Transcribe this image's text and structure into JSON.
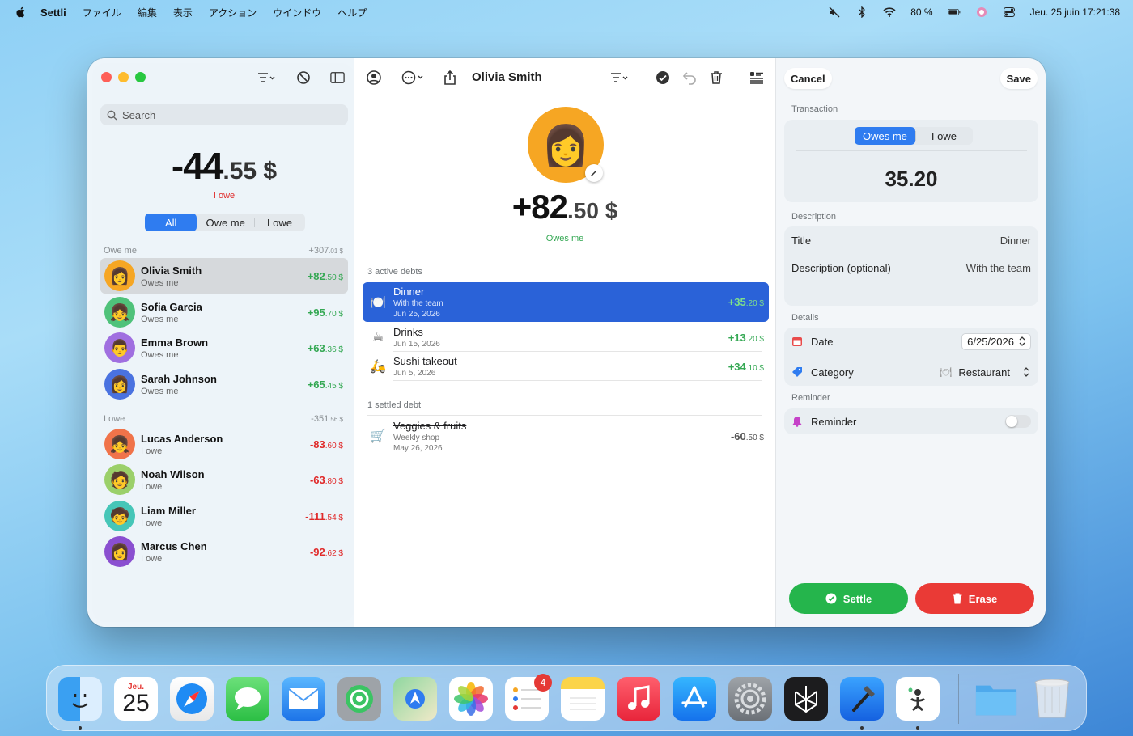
{
  "menubar": {
    "app_name": "Settli",
    "items": [
      "ファイル",
      "編集",
      "表示",
      "アクション",
      "ウインドウ",
      "ヘルプ"
    ],
    "battery": "80 %",
    "datetime": "Jeu. 25 juin  17:21:38"
  },
  "sidebar": {
    "search_placeholder": "Search",
    "total_main": "-44",
    "total_cents": ".55 $",
    "total_status": "I owe",
    "filters": [
      "All",
      "Owe me",
      "I owe"
    ],
    "owe_me_section": {
      "label": "Owe me",
      "amount_main": "+307",
      "amount_cents": ".01 $"
    },
    "i_owe_section": {
      "label": "I owe",
      "amount_main": "-351",
      "amount_cents": ".56 $"
    },
    "owe_me_people": [
      {
        "name": "Olivia Smith",
        "status": "Owes me",
        "amount_main": "+82",
        "amount_cents": ".50 $",
        "color": "#f6a623",
        "emoji": "👩"
      },
      {
        "name": "Sofia Garcia",
        "status": "Owes me",
        "amount_main": "+95",
        "amount_cents": ".70 $",
        "color": "#4fc27a",
        "emoji": "👧"
      },
      {
        "name": "Emma Brown",
        "status": "Owes me",
        "amount_main": "+63",
        "amount_cents": ".36 $",
        "color": "#a06fe0",
        "emoji": "👨"
      },
      {
        "name": "Sarah Johnson",
        "status": "Owes me",
        "amount_main": "+65",
        "amount_cents": ".45 $",
        "color": "#4a72e0",
        "emoji": "👩"
      }
    ],
    "i_owe_people": [
      {
        "name": "Lucas Anderson",
        "status": "I owe",
        "amount_main": "-83",
        "amount_cents": ".60 $",
        "color": "#f0734a",
        "emoji": "👧"
      },
      {
        "name": "Noah Wilson",
        "status": "I owe",
        "amount_main": "-63",
        "amount_cents": ".80 $",
        "color": "#9bd06a",
        "emoji": "🧑"
      },
      {
        "name": "Liam Miller",
        "status": "I owe",
        "amount_main": "-111",
        "amount_cents": ".54 $",
        "color": "#46c6b8",
        "emoji": "🧒"
      },
      {
        "name": "Marcus Chen",
        "status": "I owe",
        "amount_main": "-92",
        "amount_cents": ".62 $",
        "color": "#8a4fd0",
        "emoji": "👩"
      }
    ]
  },
  "detail": {
    "person_name": "Olivia Smith",
    "total_main": "+82",
    "total_cents": ".50 $",
    "status": "Owes me",
    "active_header": "3 active debts",
    "active_debts": [
      {
        "title": "Dinner",
        "subtitle": "With the team",
        "date": "Jun 25, 2026",
        "amount_main": "+35",
        "amount_cents": ".20 $",
        "icon": "🍽️"
      },
      {
        "title": "Drinks",
        "subtitle": "",
        "date": "Jun 15, 2026",
        "amount_main": "+13",
        "amount_cents": ".20 $",
        "icon": "☕"
      },
      {
        "title": "Sushi takeout",
        "subtitle": "",
        "date": "Jun 5, 2026",
        "amount_main": "+34",
        "amount_cents": ".10 $",
        "icon": "🛵"
      }
    ],
    "settled_header": "1 settled debt",
    "settled_debts": [
      {
        "title": "Veggies & fruits",
        "subtitle": "Weekly shop",
        "date": "May 26, 2026",
        "amount_main": "-60",
        "amount_cents": ".50 $",
        "icon": "🛒"
      }
    ]
  },
  "editor": {
    "cancel": "Cancel",
    "save": "Save",
    "transaction_label": "Transaction",
    "type_options": [
      "Owes me",
      "I owe"
    ],
    "amount": "35.20",
    "description_label": "Description",
    "title_label": "Title",
    "title_value": "Dinner",
    "desc_label": "Description (optional)",
    "desc_value": "With the team",
    "details_label": "Details",
    "date_label": "Date",
    "date_value": "6/25/2026",
    "category_label": "Category",
    "category_value": "Restaurant",
    "reminder_section": "Reminder",
    "reminder_label": "Reminder",
    "reminder_on": false,
    "settle": "Settle",
    "erase": "Erase"
  },
  "dock": {
    "calendar_month": "Jeu.",
    "calendar_day": "25",
    "reminders_badge": "4"
  }
}
